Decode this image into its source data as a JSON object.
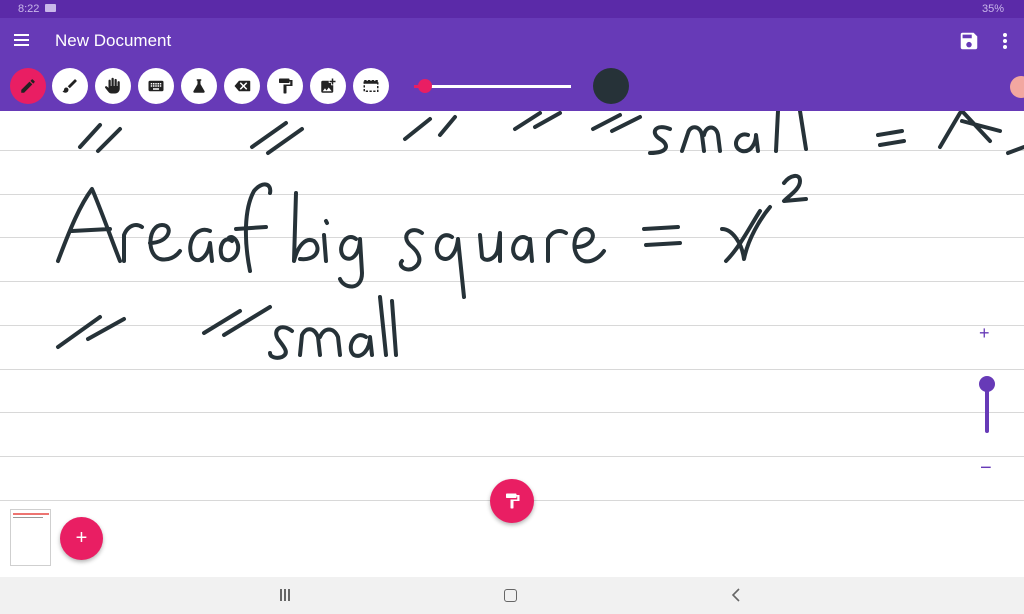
{
  "status_bar": {
    "time": "8:22",
    "battery": "35%"
  },
  "app_bar": {
    "title": "New Document"
  },
  "toolbar": {
    "tools": [
      "pen-icon",
      "brush-icon",
      "hand-icon",
      "keyboard-icon",
      "flask-icon",
      "eraser-icon",
      "paint-roller-icon",
      "add-image-icon",
      "selection-icon"
    ],
    "active_tool": "pen-icon",
    "stroke_size": 0.06,
    "color": "#263238"
  },
  "canvas": {
    "handwriting": [
      "Area of big square = x²",
      "small"
    ],
    "zoom_plus": "+",
    "zoom_minus": "−",
    "zoom_level": 0.3
  },
  "pages": {
    "add_label": "+"
  },
  "colors": {
    "accent": "#e91e63",
    "primary": "#673ab7",
    "primary_dark": "#5b2aa8"
  }
}
